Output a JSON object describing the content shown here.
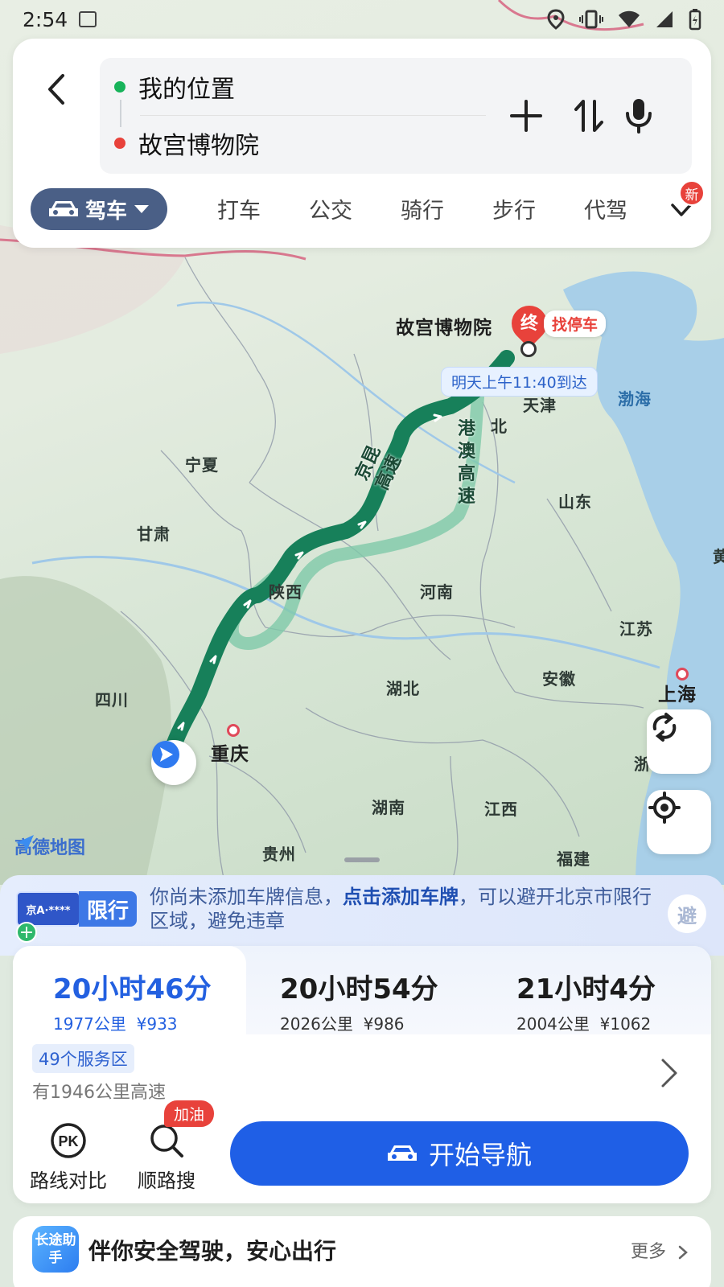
{
  "status_bar": {
    "time": "2:54"
  },
  "search": {
    "origin": "我的位置",
    "destination": "故宫博物院",
    "colors": {
      "origin_dot": "#17b35a",
      "destination_dot": "#e8423b"
    }
  },
  "modes": {
    "active": "驾车",
    "tabs": [
      "打车",
      "公交",
      "骑行",
      "步行",
      "代驾"
    ],
    "new_badge": "新"
  },
  "map": {
    "destination_label": "故宫博物院",
    "end_marker": "终",
    "parking_label": "找停车",
    "eta_label": "明天上午11:40到达",
    "road_label_1": "京昆高速",
    "road_label_2": "港澳高速",
    "regions": {
      "tianjin": "天津",
      "bohai": "渤海",
      "hebei": "北",
      "ningxia": "宁夏",
      "shandong": "山东",
      "gansu": "甘肃",
      "shaanxi": "陕西",
      "henan": "河南",
      "jiangsu": "江苏",
      "anhui": "安徽",
      "hubei": "湖北",
      "shanghai": "上海",
      "sichuan": "四川",
      "chongqing": "重庆",
      "zhe": "浙",
      "hunan": "湖南",
      "jiangxi": "江西",
      "guizhou": "贵州",
      "fujian": "福建",
      "huang": "黄"
    },
    "logo_text": "高德地图"
  },
  "restriction": {
    "plate_text": "京A·****",
    "badge": "限行",
    "text_before": "你尚未添加车牌信息，",
    "link_text": "点击添加车牌",
    "text_after": "，可以避开北京市限行区域，避免违章",
    "avoid_label": "避"
  },
  "routes": [
    {
      "duration": "20小时46分",
      "distance": "1977公里",
      "cost": "¥933"
    },
    {
      "duration": "20小时54分",
      "distance": "2026公里",
      "cost": "¥986"
    },
    {
      "duration": "21小时4分",
      "distance": "2004公里",
      "cost": "¥1062"
    }
  ],
  "route_info": {
    "service_areas": "49个服务区",
    "highway": "有1946公里高速"
  },
  "tools": {
    "compare": "路线对比",
    "compare_icon_text": "PK",
    "search_along": "顺路搜",
    "fuel_badge": "加油"
  },
  "start_nav": "开始导航",
  "assist": {
    "icon_text": "长途助手",
    "title": "伴你安全驾驶，安心出行",
    "more": "更多"
  },
  "colors": {
    "accent": "#1f5fe6",
    "route_main": "#17805a",
    "route_alt": "#7fc9a9"
  }
}
